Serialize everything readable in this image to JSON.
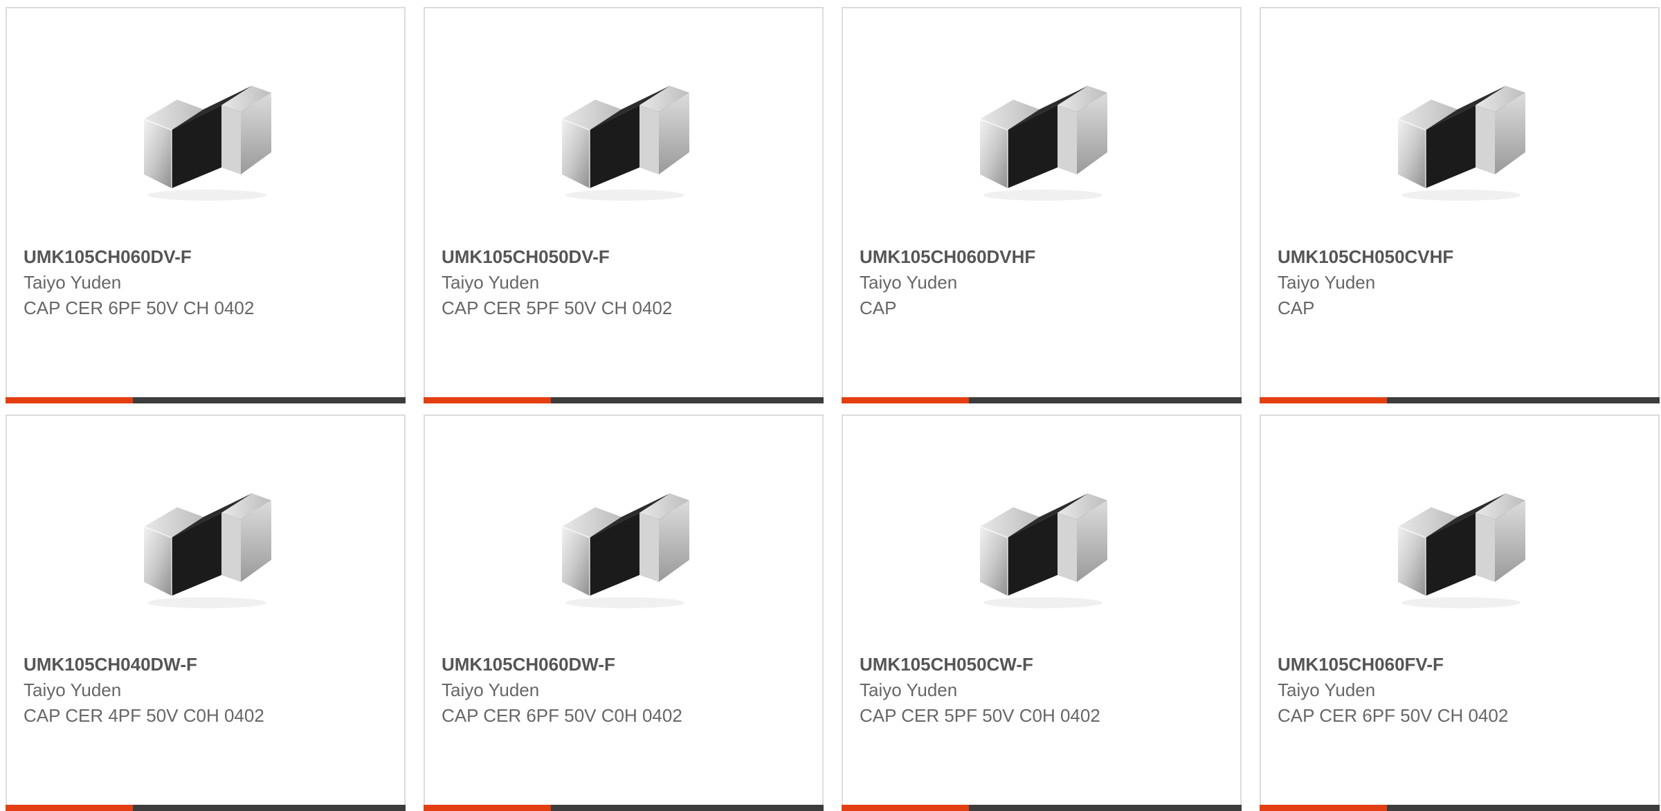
{
  "colors": {
    "accent": "#e43f12",
    "bar": "#3d3d3d",
    "border": "#dcdcdc",
    "title": "#555555",
    "text": "#666666"
  },
  "products": [
    {
      "part_number": "UMK105CH060DV-F",
      "manufacturer": "Taiyo Yuden",
      "description": "CAP CER 6PF 50V CH 0402",
      "image_icon": "chip-capacitor-image"
    },
    {
      "part_number": "UMK105CH050DV-F",
      "manufacturer": "Taiyo Yuden",
      "description": "CAP CER 5PF 50V CH 0402",
      "image_icon": "chip-capacitor-image"
    },
    {
      "part_number": "UMK105CH060DVHF",
      "manufacturer": "Taiyo Yuden",
      "description": "CAP",
      "image_icon": "chip-capacitor-image"
    },
    {
      "part_number": "UMK105CH050CVHF",
      "manufacturer": "Taiyo Yuden",
      "description": "CAP",
      "image_icon": "chip-capacitor-image"
    },
    {
      "part_number": "UMK105CH040DW-F",
      "manufacturer": "Taiyo Yuden",
      "description": "CAP CER 4PF 50V C0H 0402",
      "image_icon": "chip-capacitor-image"
    },
    {
      "part_number": "UMK105CH060DW-F",
      "manufacturer": "Taiyo Yuden",
      "description": "CAP CER 6PF 50V C0H 0402",
      "image_icon": "chip-capacitor-image"
    },
    {
      "part_number": "UMK105CH050CW-F",
      "manufacturer": "Taiyo Yuden",
      "description": "CAP CER 5PF 50V C0H 0402",
      "image_icon": "chip-capacitor-image"
    },
    {
      "part_number": "UMK105CH060FV-F",
      "manufacturer": "Taiyo Yuden",
      "description": "CAP CER 6PF 50V CH 0402",
      "image_icon": "chip-capacitor-image"
    }
  ]
}
